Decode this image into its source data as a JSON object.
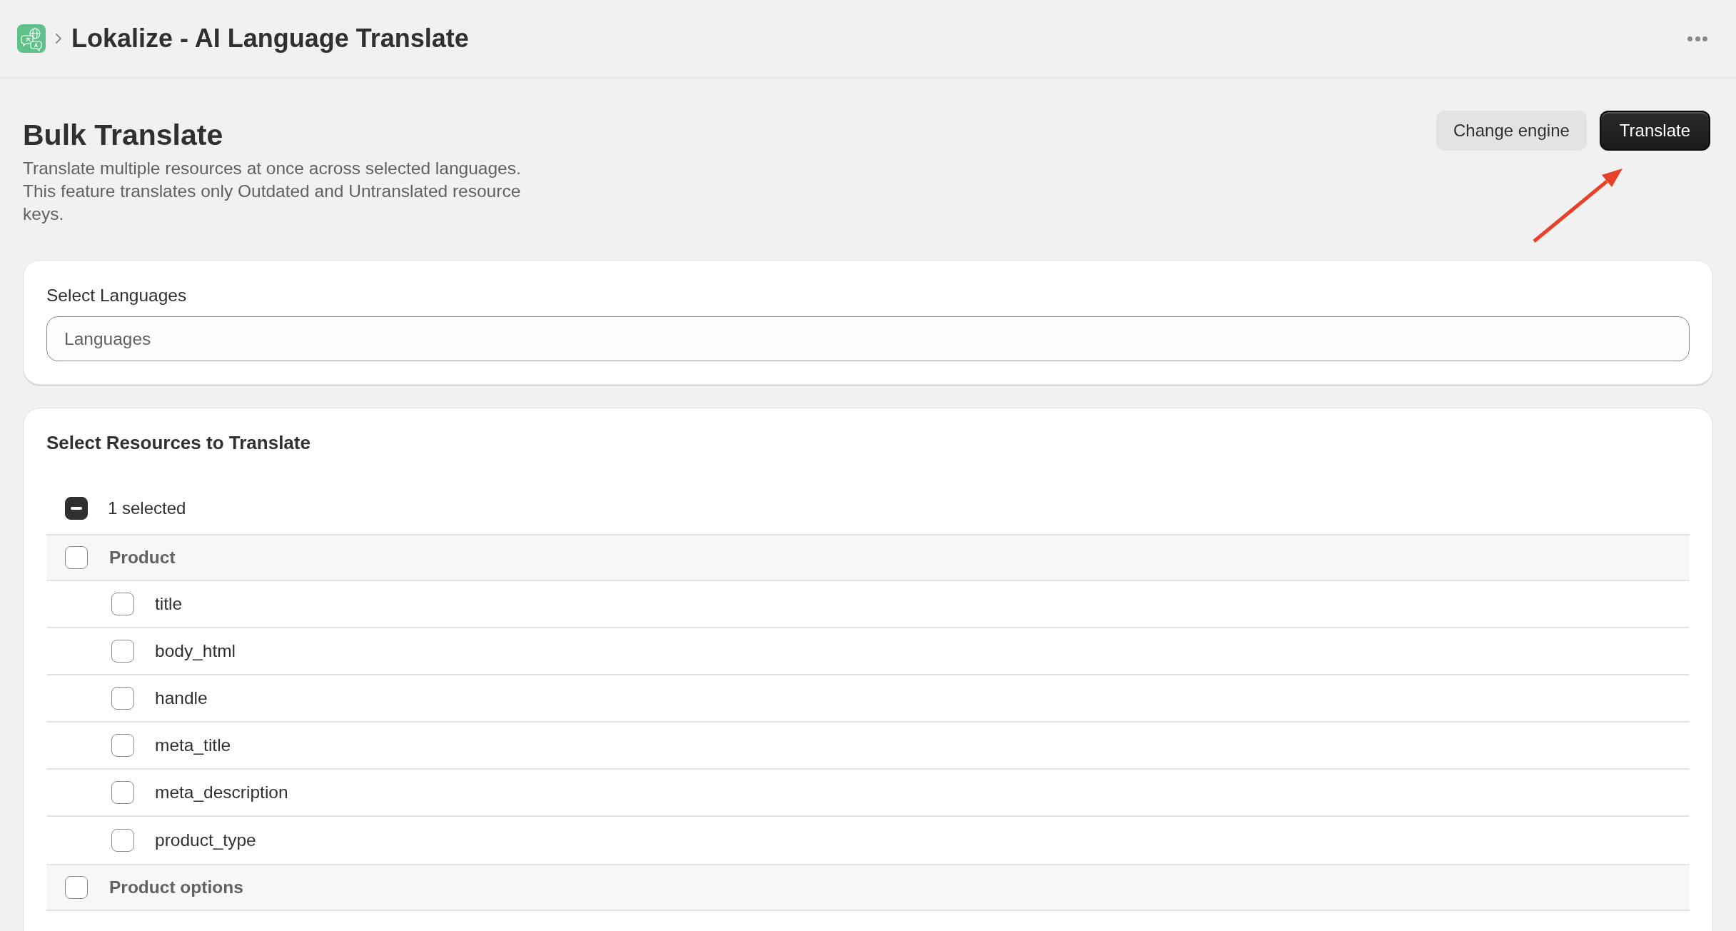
{
  "app_bar": {
    "title": "Lokalize - AI Language Translate"
  },
  "page": {
    "title": "Bulk Translate",
    "description": "Translate multiple resources at once across selected languages. This feature translates only Outdated and Untranslated resource keys.",
    "actions": [
      {
        "label": "Change engine",
        "kind": "secondary"
      },
      {
        "label": "Translate",
        "kind": "primary"
      }
    ]
  },
  "languages": {
    "label": "Select Languages",
    "placeholder": "Languages"
  },
  "resources": {
    "title": "Select Resources to Translate",
    "select_all": {
      "label": "1 selected",
      "indeterminate": true
    },
    "groups": [
      {
        "label": "Product",
        "checked": false,
        "children": [
          {
            "label": "title",
            "checked": false
          },
          {
            "label": "body_html",
            "checked": false
          },
          {
            "label": "handle",
            "checked": false
          },
          {
            "label": "meta_title",
            "checked": false
          },
          {
            "label": "meta_description",
            "checked": false
          },
          {
            "label": "product_type",
            "checked": false
          }
        ]
      },
      {
        "label": "Product options",
        "checked": false
      }
    ]
  }
}
